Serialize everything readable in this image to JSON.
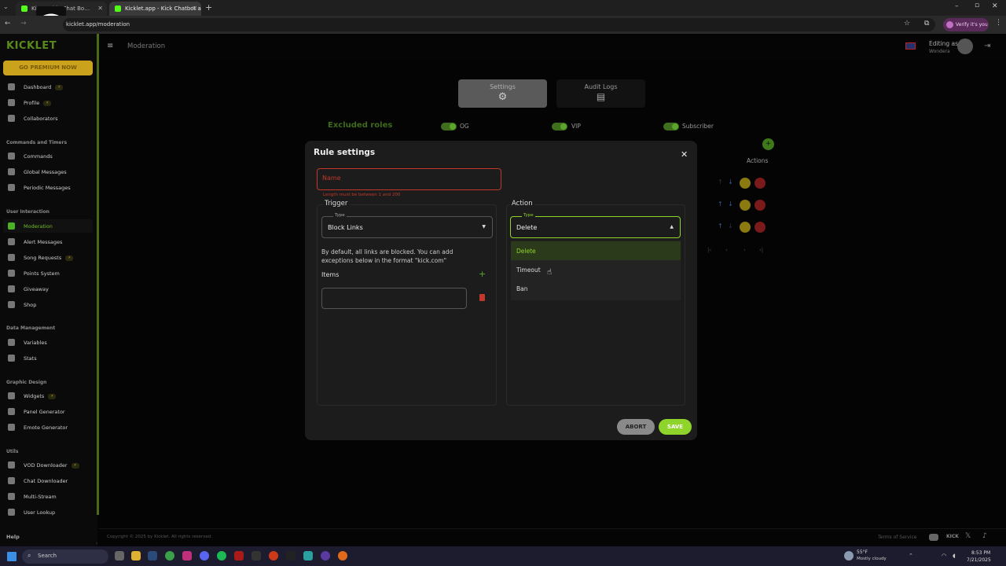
{
  "browser": {
    "tabs": [
      {
        "label": "Kic… …ble Chat Bo…"
      },
      {
        "label": "Kicklet.app - Kick Chatbot and…"
      }
    ],
    "new_tab": "+",
    "url": "kicklet.app/moderation",
    "profile_label": "Verify it's you"
  },
  "sidebar": {
    "logo": "KICKLET",
    "premium": "GO PREMIUM NOW",
    "items_top": [
      {
        "label": "Dashboard",
        "badge": "⚡"
      },
      {
        "label": "Profile",
        "badge": "⚡"
      },
      {
        "label": "Collaborators"
      }
    ],
    "sections": {
      "commands": "Commands and Timers",
      "interaction": "User Interaction",
      "data": "Data Management",
      "graphic": "Graphic Design",
      "utils": "Utils"
    },
    "commands_items": [
      {
        "label": "Commands"
      },
      {
        "label": "Global Messages"
      },
      {
        "label": "Periodic Messages"
      }
    ],
    "interaction_items": [
      {
        "label": "Moderation"
      },
      {
        "label": "Alert Messages"
      },
      {
        "label": "Song Requests",
        "badge": "⚡"
      },
      {
        "label": "Points System"
      },
      {
        "label": "Giveaway"
      },
      {
        "label": "Shop"
      }
    ],
    "data_items": [
      {
        "label": "Variables"
      },
      {
        "label": "Stats"
      }
    ],
    "graphic_items": [
      {
        "label": "Widgets",
        "badge": "⚡"
      },
      {
        "label": "Panel Generator"
      },
      {
        "label": "Emote Generator"
      }
    ],
    "utils_items": [
      {
        "label": "VOD Downloader",
        "badge": "⚡"
      },
      {
        "label": "Chat Downloader"
      },
      {
        "label": "Multi-Stream"
      },
      {
        "label": "User Lookup"
      }
    ],
    "help": "Help"
  },
  "topbar": {
    "page": "Moderation",
    "editing_as": "Editing as",
    "user": "Wondera"
  },
  "page": {
    "tab_settings": "Settings",
    "tab_audit": "Audit Logs",
    "excluded_roles": "Excluded roles",
    "roles": [
      "OG",
      "VIP",
      "Subscriber"
    ],
    "actions_header": "Actions"
  },
  "modal": {
    "title": "Rule settings",
    "name_placeholder": "Name",
    "name_error": "Length must be between 1 and 200",
    "trigger_title": "Trigger",
    "trigger_type_label": "Type",
    "trigger_type_value": "Block Links",
    "trigger_help": "By default, all links are blocked. You can add exceptions below in the format \"kick.com\"",
    "items_label": "Items",
    "action_title": "Action",
    "action_type_label": "Type",
    "action_type_value": "Delete",
    "options": [
      "Delete",
      "Timeout",
      "Ban"
    ],
    "abort": "ABORT",
    "save": "SAVE"
  },
  "footer": {
    "copyright": "Copyright © 2025 by Kicklet. All rights reserved.",
    "terms": "Terms of Service"
  },
  "taskbar": {
    "search": "Search",
    "weather_temp": "55°F",
    "weather_desc": "Mostly cloudy",
    "time": "8:53 PM",
    "date": "7/21/2025"
  },
  "colors": {
    "accent": "#6fbf23",
    "premium": "#caa21c",
    "error": "#c0392b",
    "save": "#8fd42a",
    "abort": "#8a8a8a"
  }
}
